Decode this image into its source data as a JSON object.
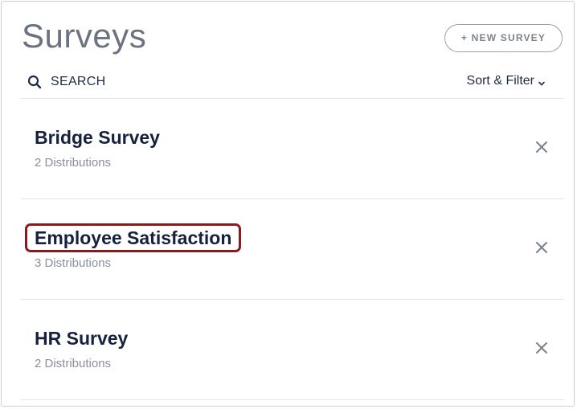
{
  "page": {
    "title": "Surveys",
    "new_survey_label": "+ NEW SURVEY"
  },
  "toolbar": {
    "search_label": "SEARCH",
    "search_icon": "search-icon",
    "sort_filter_label": "Sort & Filter",
    "sort_filter_icon": "chevron-down-icon"
  },
  "surveys": [
    {
      "name": "Bridge Survey",
      "distributions": "2 Distributions",
      "highlighted": false
    },
    {
      "name": "Employee Satisfaction",
      "distributions": "3 Distributions",
      "highlighted": true
    },
    {
      "name": "HR Survey",
      "distributions": "2 Distributions",
      "highlighted": false
    }
  ],
  "colors": {
    "title": "#6b7280",
    "survey_name": "#15213d",
    "highlight_border": "#8b1a1f",
    "muted_text": "#8a9099"
  }
}
